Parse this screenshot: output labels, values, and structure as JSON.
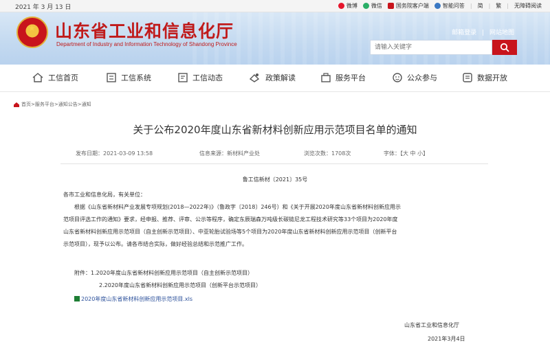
{
  "topbar": {
    "date": "2021 年 3 月 13 日",
    "links": [
      "微博",
      "微信",
      "国务院客户端",
      "智能问答",
      "简",
      "繁",
      "无障碍阅读"
    ]
  },
  "header": {
    "title": "山东省工业和信息化厅",
    "subtitle": "Department of Industry and Information Technology of Shandong Province",
    "mail_login": "邮箱登录",
    "sep": "|",
    "sitemap": "网站地图",
    "search_placeholder": "请输入关键字"
  },
  "nav": [
    {
      "label": "工信首页",
      "icon": "home-icon"
    },
    {
      "label": "工信系统",
      "icon": "system-icon"
    },
    {
      "label": "工信动态",
      "icon": "news-icon"
    },
    {
      "label": "政策解读",
      "icon": "policy-icon"
    },
    {
      "label": "服务平台",
      "icon": "service-icon"
    },
    {
      "label": "公众参与",
      "icon": "people-icon"
    },
    {
      "label": "数据开放",
      "icon": "data-icon"
    }
  ],
  "breadcrumb": "首页>服务平台>通知公告>通知",
  "article": {
    "title": "关于公布2020年度山东省新材料创新应用示范项目名单的通知",
    "publish_time": "发布日期：2021-03-09 13:58",
    "source": "信息来源：新材料产业处",
    "views": "浏览次数：1708次",
    "font_size": "字体：【大 中 小】",
    "doc_number": "鲁工信新材〔2021〕35号",
    "salutation": "各市工业和信息化局，有关单位：",
    "lines": [
      "根据《山东省新材料产业发展专项规划(2018—2022年)》（鲁政字〔2018〕246号）和《关于开展2020年度山东省新材料创新应用示",
      "范项目评选工作的通知》要求，经申报、推荐、评审、公示等程序，确定东辰瑞森万吨级长碳链尼龙工程技术研究等33个项目为2020年度",
      "山东省新材料创新应用示范项目（自主创新示范项目）、中亚轮胎试验场等5个项目为2020年度山东省新材料创新应用示范项目（创新平台",
      "示范项目），现予以公布。请各市结合实际，做好经验总结和示范推广工作。"
    ],
    "attachment_1": "附件：1.2020年度山东省新材料创新应用示范项目（自主创新示范项目）",
    "attachment_2": "2.2020年度山东省新材料创新应用示范项目（创新平台示范项目）",
    "attachment_file": "2020年度山东省新材料创新应用示范项目.xls",
    "signer": "山东省工业和信息化厅",
    "sign_date": "2021年3月4日"
  },
  "colors": {
    "brand_red": "#c8141c",
    "link_blue": "#2a4f9a"
  }
}
